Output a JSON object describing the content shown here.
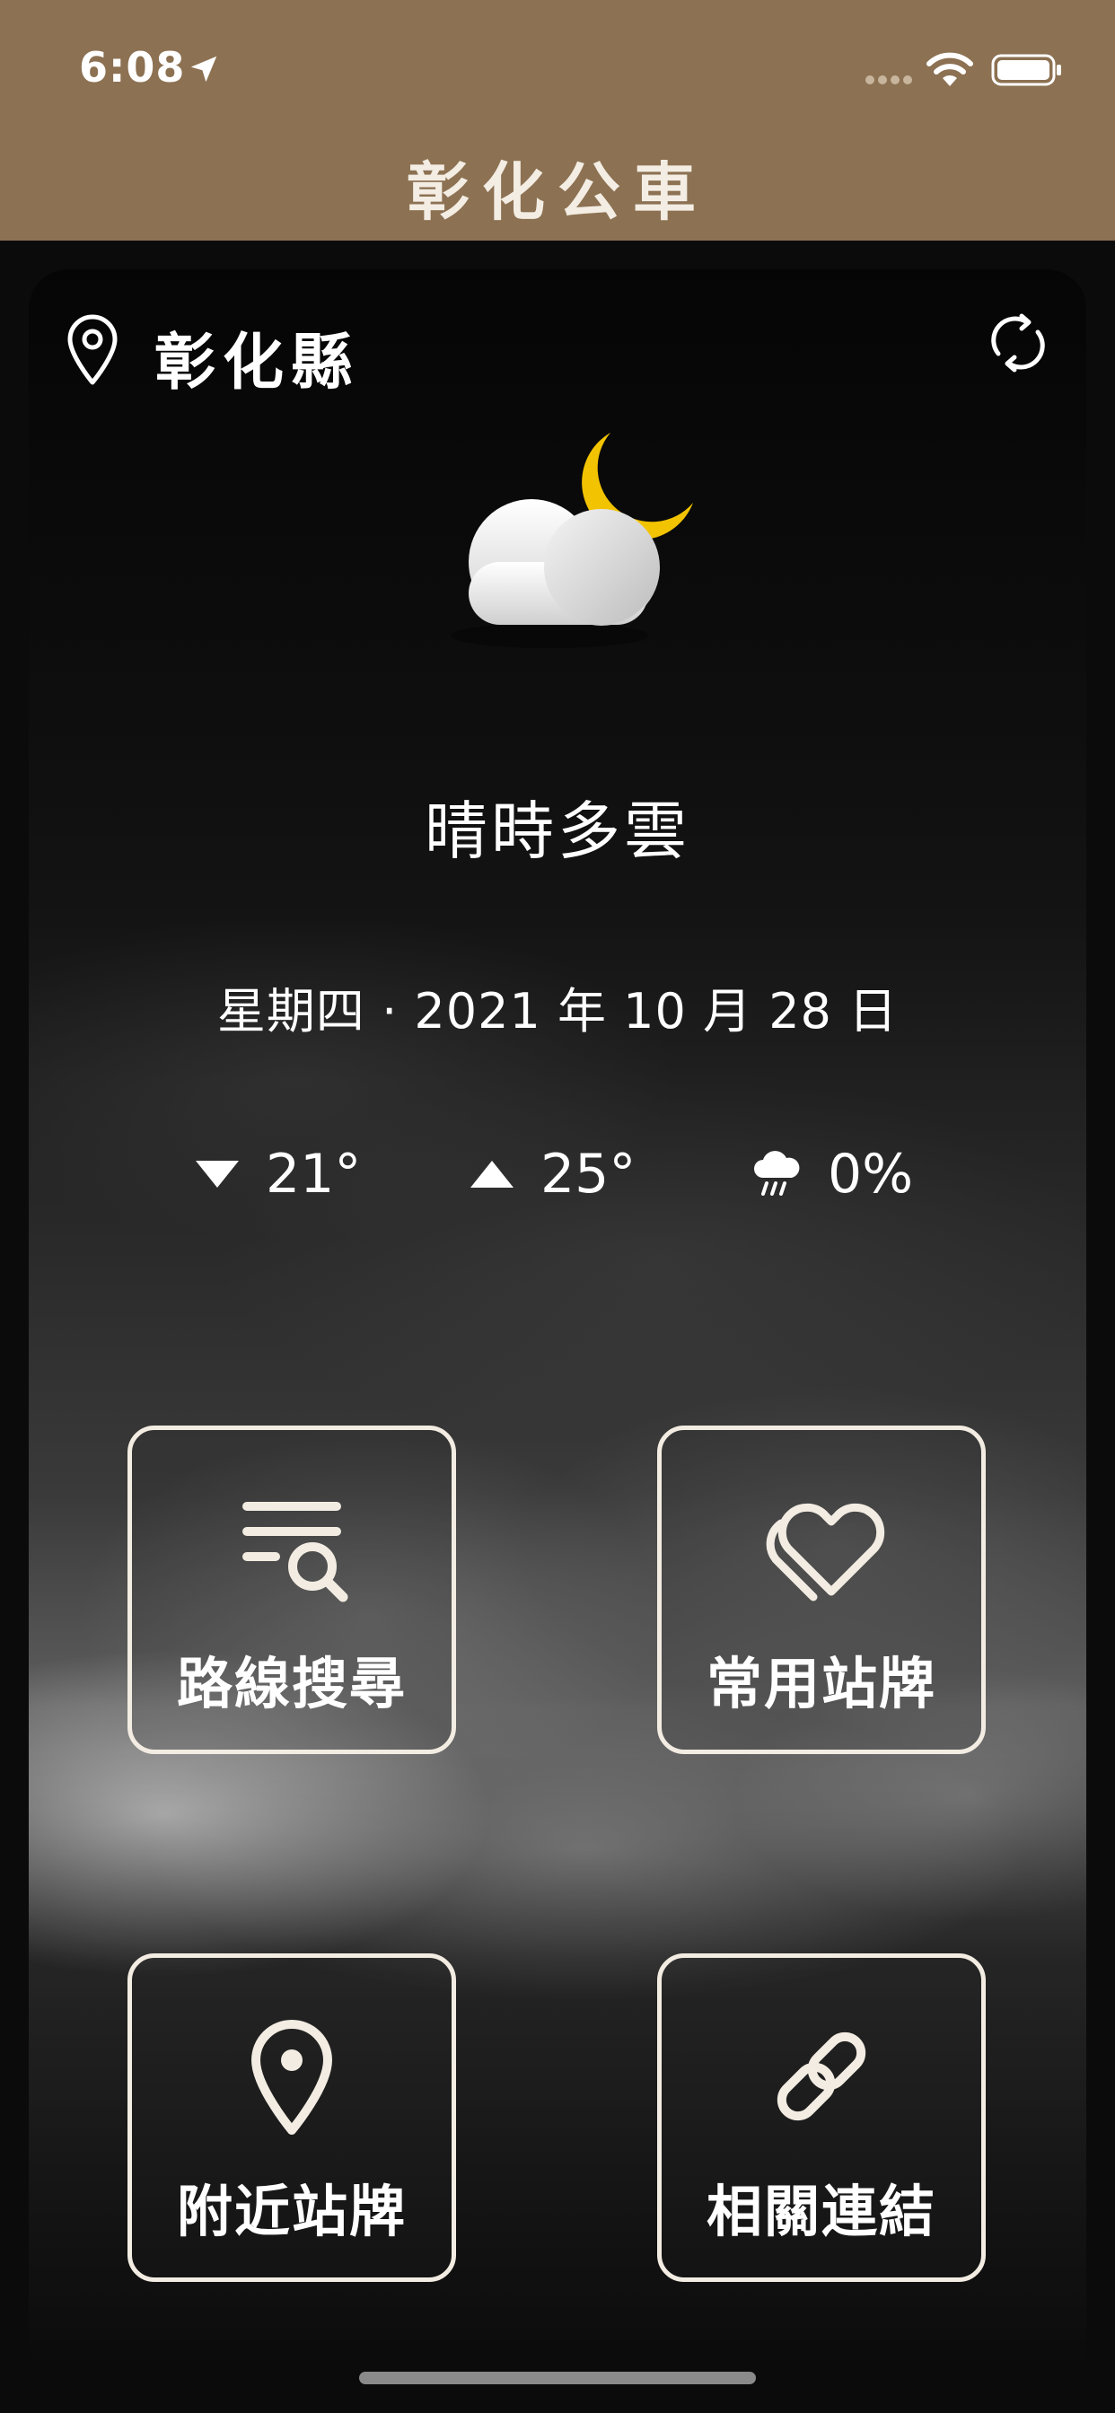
{
  "status_bar": {
    "time": "6:08"
  },
  "header": {
    "title": "彰化公車",
    "color": "#8c7152"
  },
  "location": {
    "name": "彰化縣"
  },
  "weather": {
    "description": "晴時多雲",
    "date": "星期四 · 2021 年 10 月 28 日",
    "low_temp": "21°",
    "high_temp": "25°",
    "rain_chance": "0%",
    "icon": "partly-cloudy-night-icon"
  },
  "tiles": [
    {
      "label": "路線搜尋",
      "icon": "route-search-icon"
    },
    {
      "label": "常用站牌",
      "icon": "heart-icon"
    },
    {
      "label": "附近站牌",
      "icon": "map-pin-icon"
    },
    {
      "label": "相關連結",
      "icon": "link-icon"
    }
  ]
}
